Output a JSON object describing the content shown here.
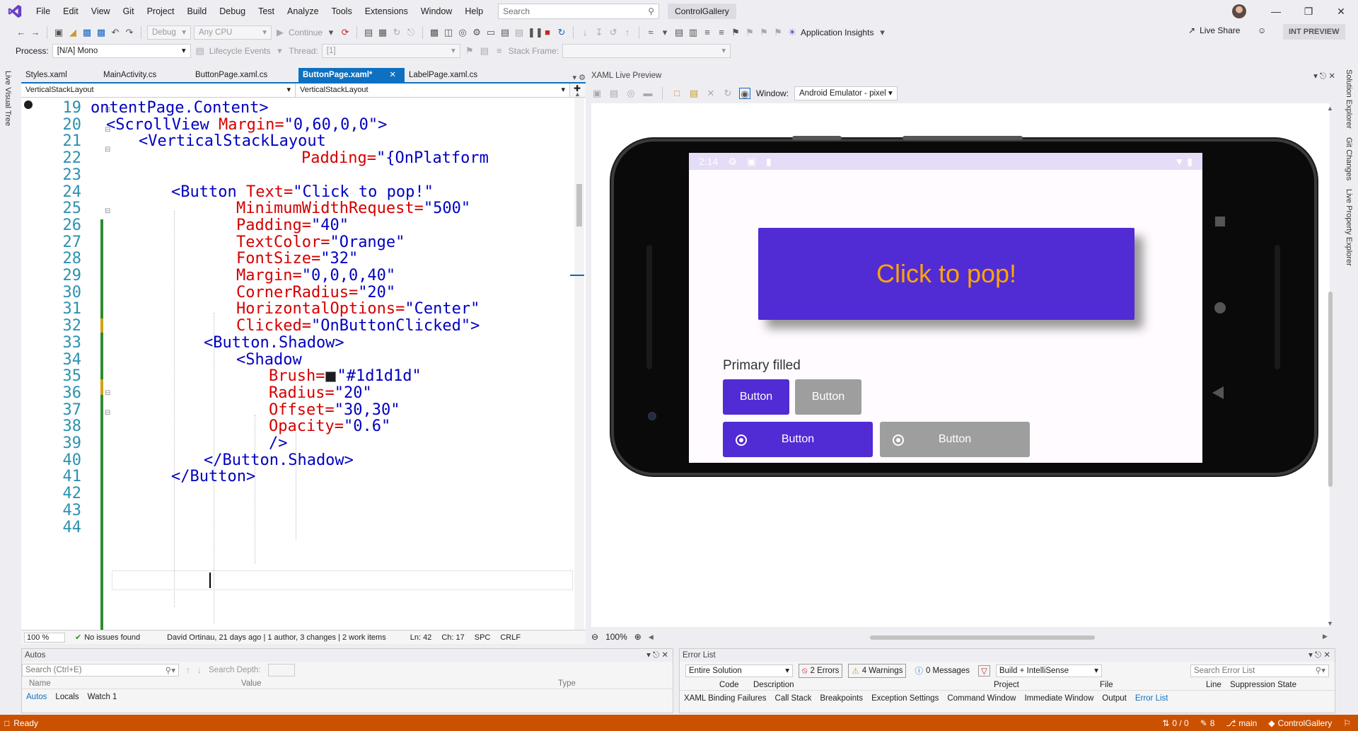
{
  "menubar": {
    "items": [
      "File",
      "Edit",
      "View",
      "Git",
      "Project",
      "Build",
      "Debug",
      "Test",
      "Analyze",
      "Tools",
      "Extensions",
      "Window",
      "Help"
    ],
    "search_placeholder": "Search",
    "solution_name": "ControlGallery"
  },
  "toolbar": {
    "config": "Debug",
    "platform": "Any CPU",
    "continue_label": "Continue",
    "app_insights": "Application Insights",
    "live_share": "Live Share",
    "int_preview": "INT PREVIEW",
    "process_label": "Process:",
    "process_value": "[N/A] Mono",
    "lifecycle_label": "Lifecycle Events",
    "thread_label": "Thread:",
    "thread_value": "[1]",
    "stack_frame_label": "Stack Frame:"
  },
  "left_strip": {
    "label": "Live Visual Tree"
  },
  "editor": {
    "tabs": [
      {
        "label": "Styles.xaml",
        "active": false
      },
      {
        "label": "MainActivity.cs",
        "active": false
      },
      {
        "label": "ButtonPage.xaml.cs",
        "active": false
      },
      {
        "label": "ButtonPage.xaml*",
        "active": true
      },
      {
        "label": "LabelPage.xaml.cs",
        "active": false
      }
    ],
    "nav_left": "VerticalStackLayout",
    "nav_right": "VerticalStackLayout",
    "line_numbers": [
      "19",
      "20",
      "21",
      "22",
      "23",
      "24",
      "25",
      "26",
      "27",
      "28",
      "29",
      "30",
      "31",
      "32",
      "33",
      "34",
      "35",
      "36",
      "37",
      "38",
      "39",
      "40",
      "41",
      "42",
      "43",
      "44"
    ],
    "code": {
      "l19": "ontentPage.Content>",
      "l20_tag": "<ScrollView",
      "l20_attr": " Margin=",
      "l20_val": "\"0,60,0,0\">",
      "l21_tag": "<VerticalStackLayout",
      "l22_attr": "Padding=",
      "l22_val": "\"{OnPlatform",
      "l24_tag": "<Button",
      "l24_attr": " Text=",
      "l24_val": "\"Click to pop!\"",
      "l25_attr": "MinimumWidthRequest=",
      "l25_val": "\"500\"",
      "l26_attr": "Padding=",
      "l26_val": "\"40\"",
      "l27_attr": "TextColor=",
      "l27_val": "\"Orange\"",
      "l28_attr": "FontSize=",
      "l28_val": "\"32\"",
      "l29_attr": "Margin=",
      "l29_val": "\"0,0,0,40\"",
      "l30_attr": "CornerRadius=",
      "l30_val": "\"20\"",
      "l31_attr": "HorizontalOptions=",
      "l31_val": "\"Center\"",
      "l32_attr": "Clicked=",
      "l32_val": "\"OnButtonClicked\">",
      "l33_tag": "<Button.Shadow>",
      "l34_tag": "<Shadow",
      "l35_attr": "Brush=",
      "l35_val": "\"#1d1d1d\"",
      "l36_attr": "Radius=",
      "l36_val": "\"20\"",
      "l37_attr": "Offset=",
      "l37_val": "\"30,30\"",
      "l38_attr": "Opacity=",
      "l38_val": "\"0.6\"",
      "l39_tag": "/>",
      "l40_tag": "</Button.Shadow>",
      "l41_tag": "</Button>"
    },
    "status": {
      "zoom": "100 %",
      "issues": "No issues found",
      "git_info": "David Ortinau, 21 days ago | 1 author, 3 changes | 2 work items",
      "ln": "Ln: 42",
      "ch": "Ch: 17",
      "spc": "SPC",
      "crlf": "CRLF"
    }
  },
  "preview": {
    "title": "XAML Live Preview",
    "window_label": "Window:",
    "window_value": "Android Emulator - pixel",
    "status_time": "2:14",
    "pop_button": "Click to pop!",
    "primary_label": "Primary filled",
    "button_1": "Button",
    "button_2": "Button",
    "button_3": "Button",
    "button_4": "Button",
    "zoom": "100%",
    "colors": {
      "pop_bg": "#512bd4",
      "pop_text": "#ffa500",
      "gray": "#9e9e9e"
    }
  },
  "right_strip": [
    "Solution Explorer",
    "Git Changes",
    "Live Property Explorer"
  ],
  "autos": {
    "title": "Autos",
    "search_placeholder": "Search (Ctrl+E)",
    "search_depth": "Search Depth:",
    "columns": [
      "Name",
      "Value",
      "Type"
    ],
    "tabs": [
      "Autos",
      "Locals",
      "Watch 1"
    ]
  },
  "error_list": {
    "title": "Error List",
    "scope": "Entire Solution",
    "errors": "2 Errors",
    "warnings": "4 Warnings",
    "messages": "0 Messages",
    "build_filter": "Build + IntelliSense",
    "search_placeholder": "Search Error List",
    "columns": [
      "Code",
      "Description",
      "Project",
      "File",
      "Line",
      "Suppression State"
    ],
    "tabs": [
      "XAML Binding Failures",
      "Call Stack",
      "Breakpoints",
      "Exception Settings",
      "Command Window",
      "Immediate Window",
      "Output",
      "Error List"
    ]
  },
  "statusbar": {
    "ready": "Ready",
    "line_changes": "0 / 0",
    "pencil_count": "8",
    "branch": "main",
    "repo": "ControlGallery"
  }
}
